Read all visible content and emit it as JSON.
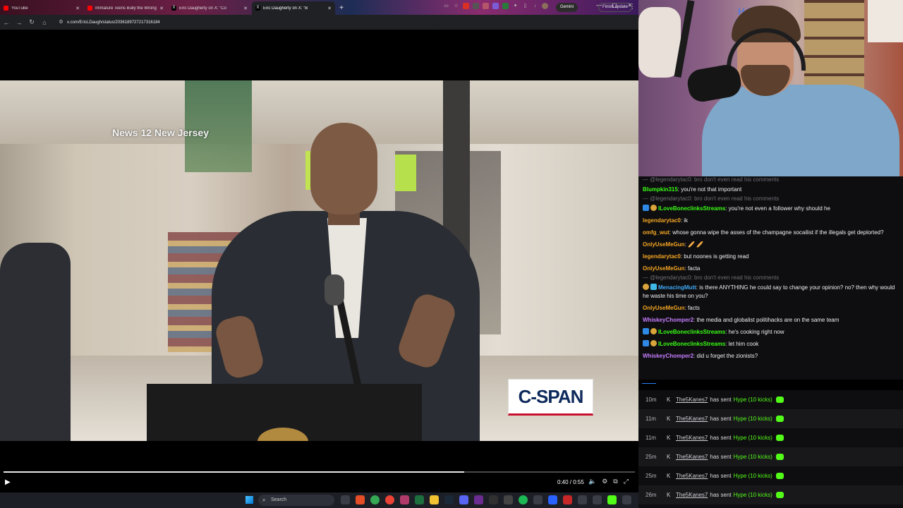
{
  "browser": {
    "tabs": [
      {
        "title": "YouTube",
        "favicon_color": "#ff0000",
        "active": false
      },
      {
        "title": "Immature Teens Bully the Wrong",
        "favicon_color": "#ff0000",
        "active": false
      },
      {
        "title": "Eric Daugherty on X: \"Co",
        "favicon_color": "#000000",
        "active": false
      },
      {
        "title": "Eric Daugherty on X: \"B",
        "favicon_color": "#000000",
        "active": true
      }
    ],
    "gemini_label": "Gemini",
    "url": "x.com/EricLDaugh/status/2036189727217316184",
    "finish_update_label": "Finish update"
  },
  "video": {
    "watermark": "News 12 New Jersey",
    "network_logo": "C-SPAN",
    "time_display": "0:40 / 0:55",
    "progress": 0.73
  },
  "taskbar": {
    "search_placeholder": "Search"
  },
  "webcam": {
    "sign_text": "HAPPY EASTER"
  },
  "chat": {
    "messages": [
      {
        "reply_to": "@legendarytac0: bro don't even read his comments",
        "user": "Blumpkin315",
        "user_color": "#39ff14",
        "text": " you're not that important",
        "badges": []
      },
      {
        "reply_to": "@legendarytac0: bro don't even read his comments",
        "user": "ILoveBoneclinksStreams",
        "user_color": "#39ff14",
        "text": " you're not even a follower why should he",
        "badges": [
          "blue",
          "gold"
        ]
      },
      {
        "reply_to": "",
        "user": "legendarytac0",
        "user_color": "#f5a623",
        "text": " ik",
        "badges": []
      },
      {
        "reply_to": "",
        "user": "omfg_wut",
        "user_color": "#f5a623",
        "text": " whose gonna wipe the asses of the champagne socailist if the illegals get deplorted?",
        "badges": []
      },
      {
        "reply_to": "",
        "user": "OnlyUseMeGun",
        "user_color": "#f5a623",
        "text": " 🥖 🥖",
        "badges": []
      },
      {
        "reply_to": "",
        "user": "legendarytac0",
        "user_color": "#f5a623",
        "text": " but noones is getting read",
        "badges": []
      },
      {
        "reply_to": "",
        "user": "OnlyUseMeGun",
        "user_color": "#f5a623",
        "text": " facta",
        "badges": []
      },
      {
        "reply_to": "@legendarytac0: bro don't even read his comments",
        "user": "MenacingMutt",
        "user_color": "#3fa9f5",
        "text": " is there ANYTHING he could say to change your opinion? no? then why would he waste his time on you?",
        "badges": [
          "gold",
          "cyan"
        ]
      },
      {
        "reply_to": "",
        "user": "OnlyUseMeGun",
        "user_color": "#f5a623",
        "text": " facts",
        "badges": []
      },
      {
        "reply_to": "",
        "user": "WhiskeyChomper2",
        "user_color": "#c77dff",
        "text": " the media and globalist politihacks are on the same team",
        "badges": []
      },
      {
        "reply_to": "",
        "user": "ILoveBoneclinksStreams",
        "user_color": "#39ff14",
        "text": " he's cooking right now",
        "badges": [
          "blue",
          "gold"
        ]
      },
      {
        "reply_to": "",
        "user": "ILoveBoneclinksStreams",
        "user_color": "#39ff14",
        "text": " let him cook",
        "badges": [
          "blue",
          "gold"
        ]
      },
      {
        "reply_to": "",
        "user": "WhiskeyChomper2",
        "user_color": "#c77dff",
        "text": " did u forget the zionists?",
        "badges": []
      }
    ]
  },
  "alerts": [
    {
      "ago": "10m",
      "user": "The5Kanes7",
      "verb": "has sent",
      "hype": "Hype (10 kicks)"
    },
    {
      "ago": "11m",
      "user": "The5Kanes7",
      "verb": "has sent",
      "hype": "Hype (10 kicks)"
    },
    {
      "ago": "11m",
      "user": "The5Kanes7",
      "verb": "has sent",
      "hype": "Hype (10 kicks)"
    },
    {
      "ago": "25m",
      "user": "The5Kanes7",
      "verb": "has sent",
      "hype": "Hype (10 kicks)"
    },
    {
      "ago": "25m",
      "user": "The5Kanes7",
      "verb": "has sent",
      "hype": "Hype (10 kicks)"
    },
    {
      "ago": "26m",
      "user": "The5Kanes7",
      "verb": "has sent",
      "hype": "Hype (10 kicks)"
    }
  ]
}
